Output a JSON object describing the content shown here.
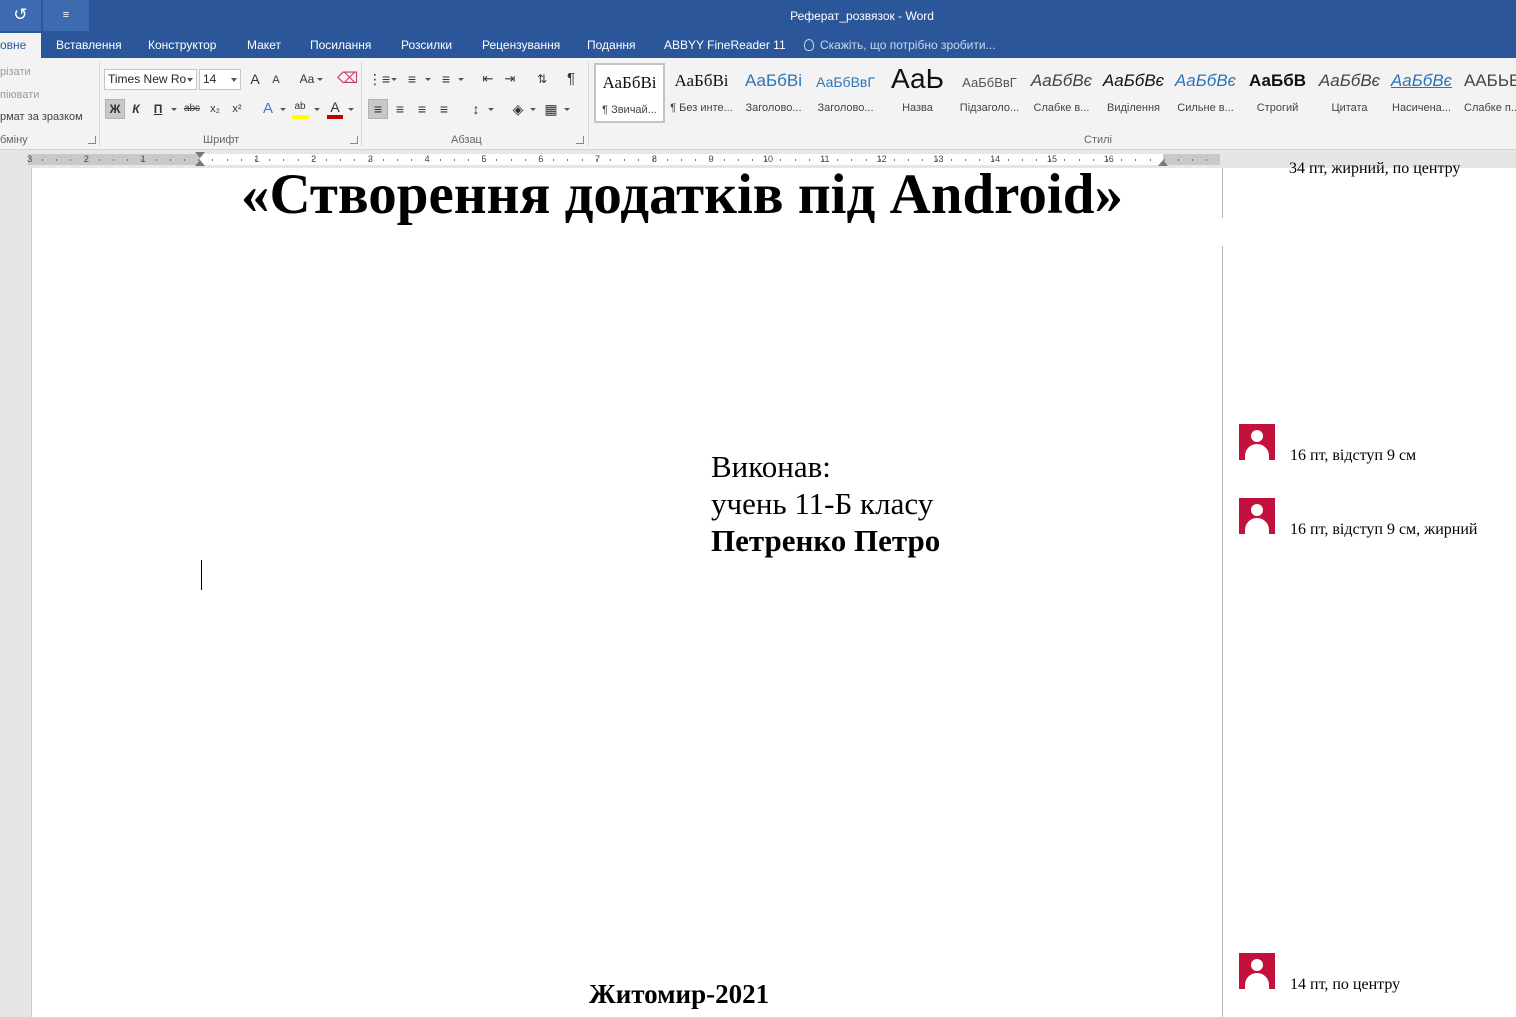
{
  "window": {
    "title": "Реферат_розвязок - Word"
  },
  "quick_access": {
    "undo_icon": "redo-arrow-icon",
    "customize_icon": "customize-arrow-icon"
  },
  "tabs": [
    "овне",
    "Вставлення",
    "Конструктор",
    "Макет",
    "Посилання",
    "Розсилки",
    "Рецензування",
    "Подання",
    "ABBYY FineReader 11"
  ],
  "tell_me": {
    "placeholder": "Скажіть, що потрібно зробити..."
  },
  "clipboard": {
    "cut": "різати",
    "copy": "піювати",
    "format_painter": "рмат за зразком",
    "group_label": "бміну"
  },
  "font": {
    "name": "Times New Ro",
    "size": "14",
    "grow": "A",
    "shrink": "A",
    "case": "Aa",
    "bold": "Ж",
    "italic": "К",
    "underline": "П",
    "strike": "abc",
    "subscript": "x₂",
    "superscript": "x²",
    "group_label": "Шрифт",
    "highlight_color": "#ffff00",
    "font_color": "#c00000"
  },
  "paragraph": {
    "group_label": "Абзац",
    "show_marks": "¶"
  },
  "styles": {
    "group_label": "Стилі",
    "items": [
      {
        "sample": "АаБбВі",
        "name": "¶ Звичай..."
      },
      {
        "sample": "АаБбВі",
        "name": "¶ Без инте..."
      },
      {
        "sample": "АаБбВі",
        "name": "Заголово..."
      },
      {
        "sample": "АаБбВвГ",
        "name": "Заголово..."
      },
      {
        "sample": "АаЬ",
        "name": "Назва"
      },
      {
        "sample": "АаБбВвГ",
        "name": "Підзаголо..."
      },
      {
        "sample": "АаБбВє",
        "name": "Слабке в..."
      },
      {
        "sample": "АаБбВє",
        "name": "Виділення"
      },
      {
        "sample": "АаБбВє",
        "name": "Сильне в..."
      },
      {
        "sample": "АаБбВ",
        "name": "Строгий"
      },
      {
        "sample": "АаБбВє",
        "name": "Цитата"
      },
      {
        "sample": "АаБбВє",
        "name": "Насичена..."
      },
      {
        "sample": "ААБЬЕ",
        "name": "Слабке п..."
      }
    ]
  },
  "ruler": {
    "left_numbers": [
      "3",
      "2",
      "1"
    ],
    "right_numbers": [
      "1",
      "2",
      "3",
      "4",
      "5",
      "6",
      "7",
      "8",
      "9",
      "10",
      "11",
      "12",
      "13",
      "14",
      "15",
      "16"
    ]
  },
  "document": {
    "title": "«Створення додатків під Android»",
    "author_label": "Виконав:",
    "author_class": "учень 11-Б класу",
    "author_name": "Петренко Петро",
    "city_year": "Житомир-2021"
  },
  "comments": {
    "clipped_text": "34 пт, жирний, по центру",
    "items": [
      {
        "text": "16 пт, відступ 9 см"
      },
      {
        "text": "16 пт, відступ 9 см, жирний"
      },
      {
        "text": "14 пт, по центру"
      }
    ],
    "avatar_color": "#c2113c"
  }
}
